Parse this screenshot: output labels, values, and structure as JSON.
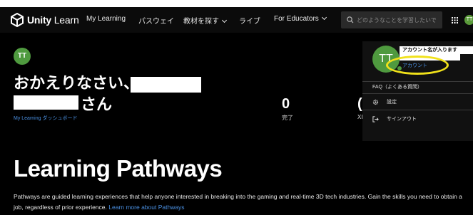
{
  "nav": {
    "logo_bold": "Unity",
    "logo_light": "Learn",
    "items": [
      {
        "label": "My Learning",
        "has_chevron": false
      },
      {
        "label": "パスウェイ",
        "has_chevron": false
      },
      {
        "label": "教材を探す",
        "has_chevron": true
      },
      {
        "label": "ライブ",
        "has_chevron": false
      },
      {
        "label": "For Educators",
        "has_chevron": true
      }
    ],
    "search_placeholder": "どのようなことを学習したいで",
    "avatar_initials": "TT"
  },
  "profile": {
    "avatar_initials": "TT",
    "welcome_line1": "おかえりなさい、",
    "welcome_suffix": "さん",
    "dashboard_link": "My Learning ダッシュボード"
  },
  "stats": [
    {
      "value": "0",
      "label": "完了"
    },
    {
      "value": "(",
      "label": "XI"
    }
  ],
  "dropdown": {
    "avatar_initials": "TT",
    "account_name": "アカウント名が入ります",
    "account_link": "アカウント",
    "faq": "FAQ（よくある質問）",
    "settings": "設定",
    "signout": "サインアウト"
  },
  "hero": {
    "title": "Learning Pathways",
    "description": "Pathways are guided learning experiences that help anyone interested in breaking into the gaming and real-time 3D tech industries. Gain the skills you need to obtain a job, regardless of prior experience.",
    "link": "Learn more about Pathways"
  },
  "colors": {
    "background": "#000000",
    "accent_link": "#4a90e2",
    "avatar_green": "#4f9a3f",
    "highlight": "#f0e11a"
  }
}
